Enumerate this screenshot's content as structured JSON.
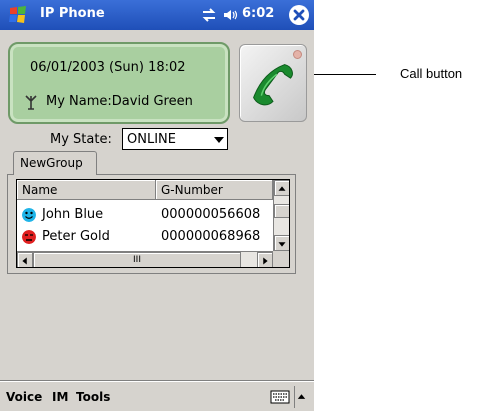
{
  "titlebar": {
    "app_title": "IP Phone",
    "time": "6:02",
    "icons": [
      "windows-start-icon",
      "sync-icon",
      "speaker-icon",
      "close-icon"
    ]
  },
  "status": {
    "datetime": "06/01/2003 (Sun)  18:02",
    "name_label": "My Name:",
    "name_value": "David Green",
    "panel_color": "#a9cfa0"
  },
  "call_button": {
    "icon": "phone-handset-icon",
    "accent_color": "#1a8a2e"
  },
  "state": {
    "label": "My State:",
    "value": "ONLINE"
  },
  "group": {
    "tab_label": "NewGroup",
    "columns": [
      "Name",
      "G-Number"
    ],
    "rows": [
      {
        "name": "John Blue",
        "number": "000000056608",
        "status_icon": "online-smiley-icon",
        "status_color": "#1fb4e8"
      },
      {
        "name": "Peter Gold",
        "number": "000000068968",
        "status_icon": "busy-smiley-icon",
        "status_color": "#e02020"
      }
    ],
    "scroll_glyph": "III"
  },
  "menubar": {
    "items": [
      "Voice",
      "IM",
      "Tools"
    ],
    "icons": [
      "keyboard-icon",
      "sip-arrow-icon"
    ]
  },
  "annotation": {
    "label": "Call button"
  }
}
